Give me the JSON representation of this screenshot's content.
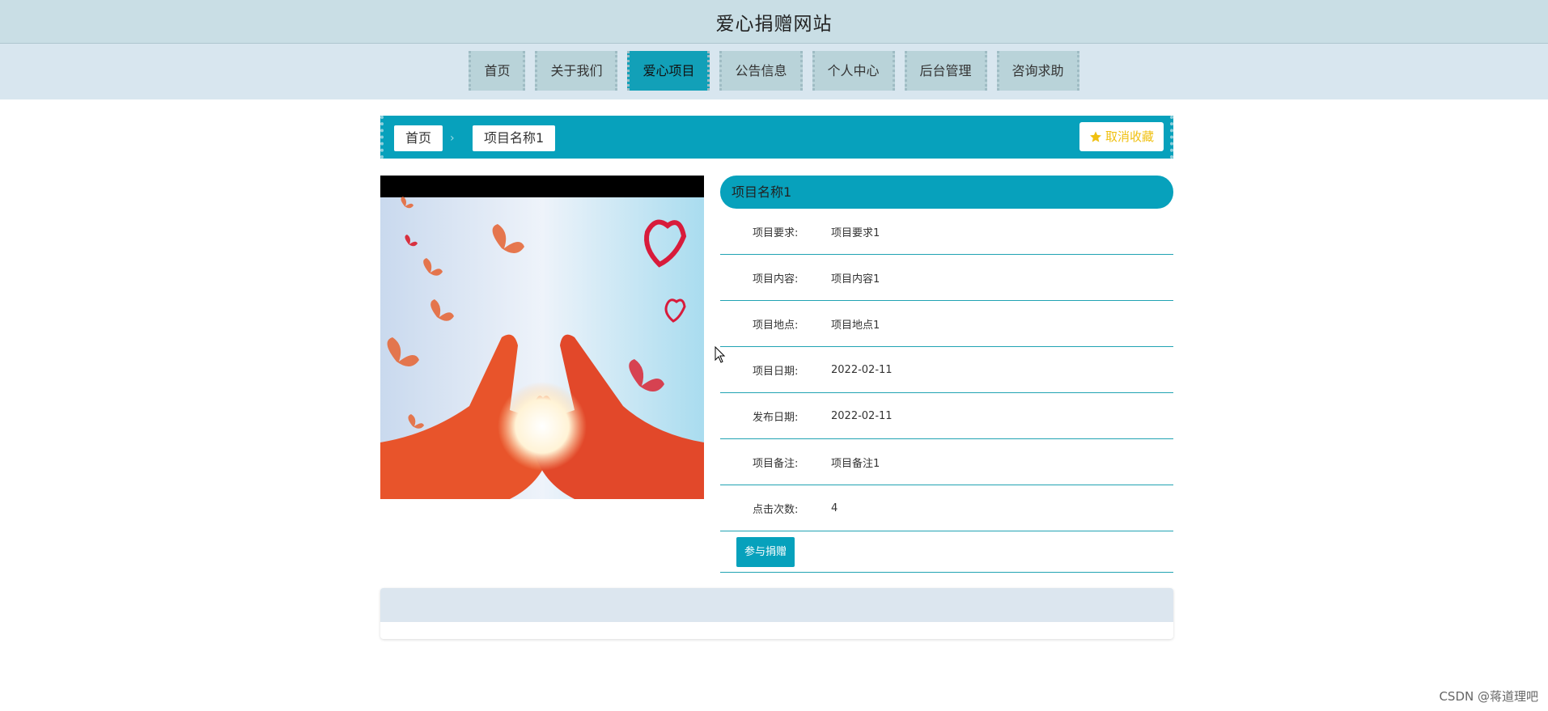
{
  "header": {
    "site_title": "爱心捐赠网站"
  },
  "nav": {
    "items": [
      {
        "label": "首页"
      },
      {
        "label": "关于我们"
      },
      {
        "label": "爱心项目"
      },
      {
        "label": "公告信息"
      },
      {
        "label": "个人中心"
      },
      {
        "label": "后台管理"
      },
      {
        "label": "咨询求助"
      }
    ],
    "active_index": 2
  },
  "breadcrumb": {
    "home": "首页",
    "current": "项目名称1",
    "favorite_button": "取消收藏",
    "favorite_icon": "star-icon"
  },
  "project": {
    "title": "项目名称1",
    "fields": [
      {
        "label": "项目要求:",
        "value": "项目要求1"
      },
      {
        "label": "项目内容:",
        "value": "项目内容1"
      },
      {
        "label": "项目地点:",
        "value": "项目地点1"
      },
      {
        "label": "项目日期:",
        "value": "2022-02-11"
      },
      {
        "label": "发布日期:",
        "value": "2022-02-11"
      },
      {
        "label": "项目备注:",
        "value": "项目备注1"
      },
      {
        "label": "点击次数:",
        "value": "4"
      }
    ],
    "donate_button": "参与捐赠"
  },
  "colors": {
    "accent": "#07a1bc",
    "header_bg": "#c9dee5",
    "nav_bg": "#d8e6ef",
    "favorite_text": "#f0c010"
  },
  "watermark": "CSDN @蒋道理吧"
}
